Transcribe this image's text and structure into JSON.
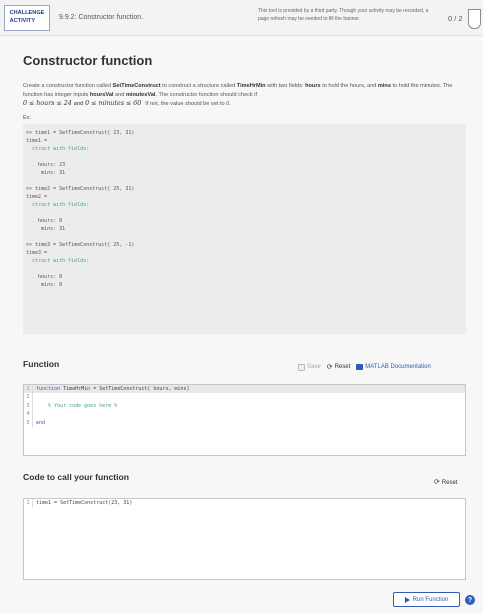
{
  "header": {
    "badge": "CHALLENGE\nACTIVITY",
    "breadcrumb": "9.9.2: Constructor function.",
    "notice": "This tool is provided by a third party. Though your activity may be recorded, a page refresh may be needed to fill the banner.",
    "score": "0 / 2"
  },
  "activity": {
    "title": "Constructor function",
    "desc_1": "Create a constructor function called ",
    "fn_name": "SetTimeConstruct",
    "desc_2": " to construct a structure called ",
    "struct_name": "TimeHrMin",
    "desc_3": " with two fields: ",
    "field_hours": "hours",
    "desc_4": " to hold the hours, and ",
    "field_mins": "mins",
    "desc_5": " to hold the minutes. The function has integer inputs ",
    "in_hours": "hoursVal",
    "desc_6": " and ",
    "in_mins": "minutesVal",
    "desc_7": ". The constructor function should check if",
    "math_1": "0 ≤ hours ≤ 24",
    "math_and": "and",
    "math_2": "0 ≤ minutes ≤ 60",
    "math_hint": "If not, the value should be set to 0.",
    "ex_label": "Ex:",
    "example_lines": [
      ">> time1 = SetTimeConstruct( 23, 31)",
      "time1 =",
      "  struct with fields:",
      "",
      "    hours: 23",
      "     mins: 31",
      "",
      ">> time2 = SetTimeConstruct( 25, 31)",
      "time2 =",
      "  struct with fields:",
      "",
      "    hours: 0",
      "     mins: 31",
      "",
      ">> time3 = SetTimeConstruct( 25, -1)",
      "time3 =",
      "  struct with fields:",
      "",
      "    hours: 0",
      "     mins: 0"
    ]
  },
  "function_section": {
    "title": "Function",
    "save_label": "Save",
    "reset_label": "Reset",
    "doc_label": "MATLAB Documentation",
    "lines": [
      {
        "n": "1",
        "kw": "function",
        "text": " TimeHrMin = SetTimeConstruct( hours, mins)"
      },
      {
        "n": "2",
        "kw": "",
        "text": ""
      },
      {
        "n": "3",
        "kw": "",
        "text": "    % Your code goes here %"
      },
      {
        "n": "4",
        "kw": "",
        "text": ""
      },
      {
        "n": "5",
        "kw": "end",
        "text": ""
      }
    ]
  },
  "call_section": {
    "title": "Code to call your function",
    "reset_label": "Reset",
    "lines": [
      {
        "n": "1",
        "text": "time1 = SetTimeConstruct(23, 31)"
      }
    ]
  },
  "actions": {
    "run_label": "Run Function",
    "help_glyph": "?"
  }
}
